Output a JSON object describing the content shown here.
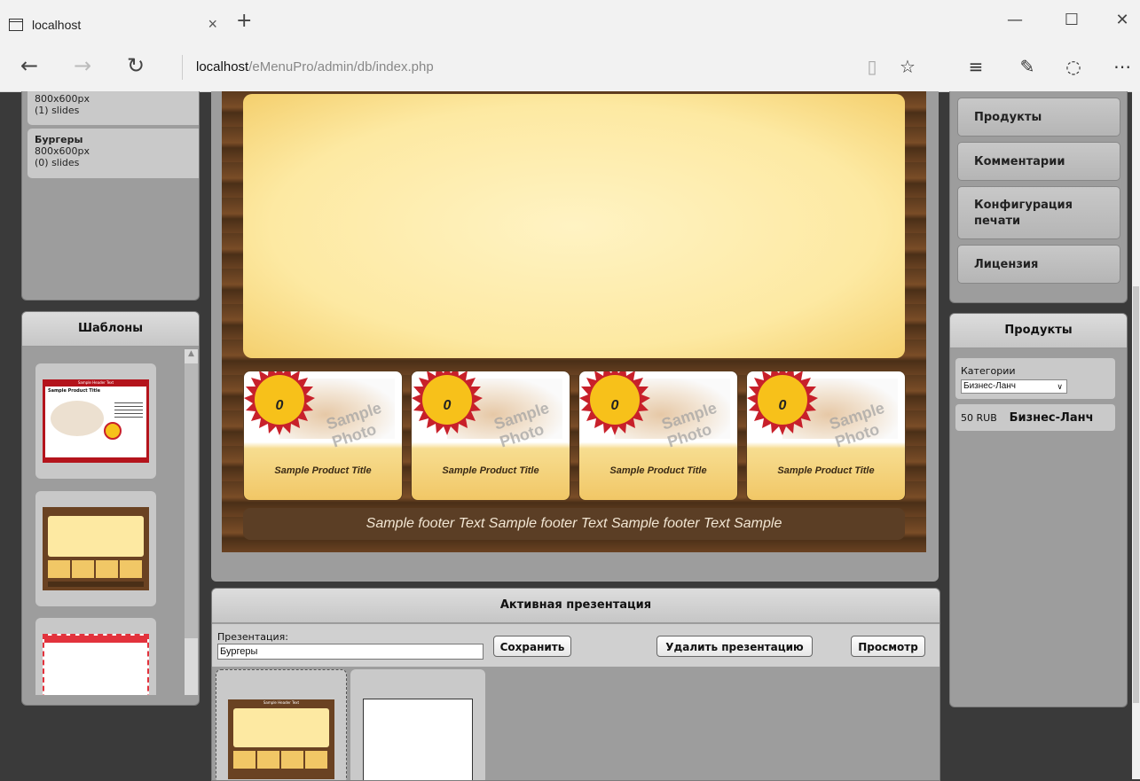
{
  "browser": {
    "tab_title": "localhost",
    "tab_close": "×",
    "new_tab": "+",
    "minimize": "—",
    "maximize": "☐",
    "close": "✕",
    "url_host": "localhost",
    "url_path": "/eMenuPro/admin/db/index.php"
  },
  "slides_list": {
    "items": [
      {
        "size": "800x600px",
        "count": "(1) slides"
      },
      {
        "name": "Бургеры",
        "size": "800x600px",
        "count": "(0) slides"
      }
    ]
  },
  "templates": {
    "title": "Шаблоны",
    "template1_header": "Sample Header Text",
    "template1_title": "Sample Product Title"
  },
  "canvas": {
    "badges": [
      "0",
      "0",
      "0",
      "0"
    ],
    "photo_label": "Sample Photo",
    "product_title": "Sample Product Title",
    "footer_text": "Sample footer Text Sample footer Text Sample footer Text Sample"
  },
  "active_presentation": {
    "title": "Активная презентация",
    "field_label": "Презентация:",
    "field_value": "Бургеры",
    "save_label": "Сохранить",
    "delete_label": "Удалить презентацию",
    "preview_label": "Просмотр",
    "thumb_header": "Sample Header Text"
  },
  "right_menu": {
    "items": [
      "Продукты",
      "Комментарии",
      "Конфигурация печати",
      "Лицензия"
    ]
  },
  "products_panel": {
    "title": "Продукты",
    "categories_label": "Категории",
    "category_selected": "Бизнес-Ланч",
    "product_price": "50 RUB",
    "product_name": "Бизнес-Ланч"
  },
  "colors": {
    "accent_red": "#c8202a",
    "badge_yellow": "#f7c11a",
    "panel_gray": "#9d9d9d"
  }
}
